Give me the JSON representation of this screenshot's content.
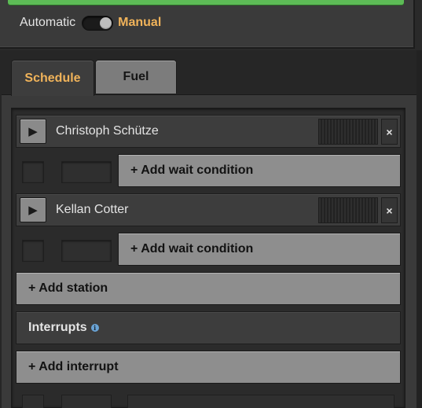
{
  "colors": {
    "accent": "#f0b35a",
    "progress_green": "#5dbb56",
    "button_grey": "#8e8e8e",
    "info_blue": "#6aa4d6"
  },
  "mode": {
    "automatic_label": "Automatic",
    "manual_label": "Manual",
    "selected": "Manual"
  },
  "tabs": [
    {
      "label": "Schedule",
      "active": true
    },
    {
      "label": "Fuel",
      "active": false
    }
  ],
  "schedule": {
    "stations": [
      {
        "name": "Christoph Schütze",
        "play_icon": "play-icon",
        "close_glyph": "×",
        "add_wait_label": "+ Add wait condition"
      },
      {
        "name": "Kellan Cotter",
        "play_icon": "play-icon",
        "close_glyph": "×",
        "add_wait_label": "+ Add wait condition"
      }
    ],
    "add_station_label": "+ Add station",
    "interrupts_label": "Interrupts",
    "info_icon": "info-icon",
    "add_interrupt_label": "+ Add interrupt"
  }
}
